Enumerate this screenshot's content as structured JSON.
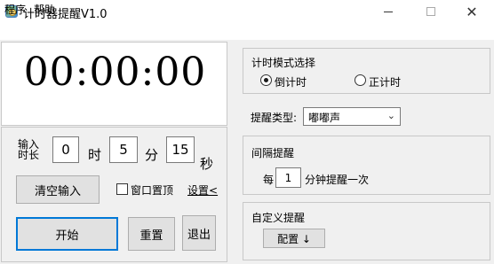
{
  "window": {
    "title": "计时器提醒V1.0",
    "minimize_icon": "minimize-icon",
    "maximize_icon": "maximize-icon",
    "close_glyph": "✕"
  },
  "menu": {
    "program": "程序",
    "help": "帮助"
  },
  "clock": {
    "display": "00:00:00"
  },
  "duration": {
    "label_line1": "输入",
    "label_line2": "时长",
    "hours_value": "0",
    "hours_unit": "时",
    "minutes_value": "5",
    "minutes_unit": "分",
    "seconds_value": "15",
    "seconds_unit": "秒"
  },
  "buttons": {
    "clear_input": "清空输入",
    "start": "开始",
    "reset": "重置",
    "exit": "退出",
    "config": "配置 ↓"
  },
  "options": {
    "always_on_top_label": "窗口置顶",
    "always_on_top_checked": false,
    "settings_link": "设置<"
  },
  "mode": {
    "group_title": "计时模式选择",
    "countdown_label": "倒计时",
    "countup_label": "正计时",
    "selected": "countdown"
  },
  "reminder": {
    "type_label": "提醒类型:",
    "type_value": "嘟嘟声"
  },
  "interval": {
    "group_title": "间隔提醒",
    "prefix": "每",
    "value": "1",
    "suffix": "分钟提醒一次"
  },
  "custom": {
    "group_title": "自定义提醒"
  }
}
